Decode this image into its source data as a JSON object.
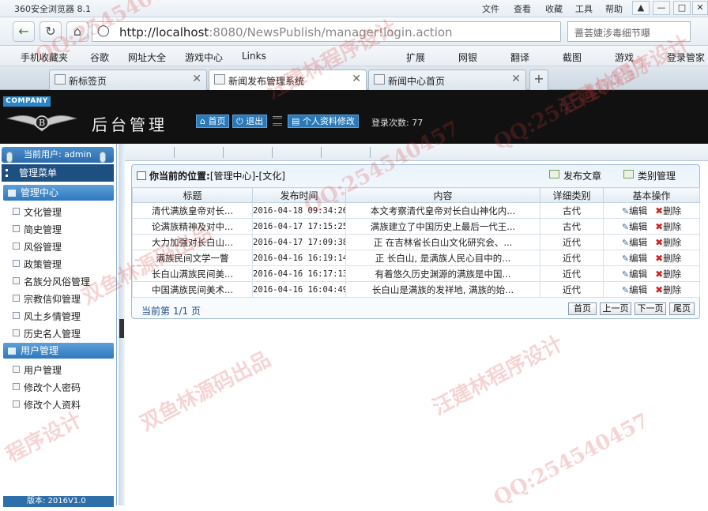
{
  "browser": {
    "title": "360安全浏览器 8.1",
    "menu": [
      "文件",
      "查看",
      "收藏",
      "工具",
      "帮助"
    ],
    "url_host": "http://localhost",
    "url_rest": ":8080/NewsPublish/manager!login.action",
    "search_text": "蔷荟婕涉毒细节曝",
    "favorites": [
      "手机收藏夹",
      "谷歌",
      "网址大全",
      "游戏中心",
      "Links"
    ],
    "tools": [
      "扩展",
      "网银",
      "翻译",
      "截图",
      "游戏",
      "登录管家"
    ],
    "tabs": [
      {
        "label": "新标签页",
        "active": false
      },
      {
        "label": "新闻发布管理系统",
        "active": true
      },
      {
        "label": "新闻中心首页",
        "active": false
      }
    ]
  },
  "header": {
    "company": "COMPANY",
    "title": "后台管理",
    "home_label": "首页",
    "logout_label": "退出",
    "profile_label": "个人资料修改",
    "login_count": "登录次数: 77"
  },
  "sidebar": {
    "current_user": "当前用户: admin",
    "menu_title": "管理菜单",
    "sections": [
      {
        "title": "管理中心",
        "items": [
          "文化管理",
          "简史管理",
          "风俗管理",
          "政策管理",
          "名族分风俗管理",
          "宗教信仰管理",
          "风土乡情管理",
          "历史名人管理"
        ]
      },
      {
        "title": "用户管理",
        "items": [
          "用户管理",
          "修改个人密码",
          "修改个人资料"
        ]
      }
    ],
    "version": "版本: 2016V1.0"
  },
  "content": {
    "location_label": "你当前的位置:",
    "location_value": "[管理中心]-[文化]",
    "publish_label": "发布文章",
    "category_label": "类别管理",
    "columns": [
      "标题",
      "发布时间",
      "内容",
      "详细类别",
      "基本操作"
    ],
    "rows": [
      {
        "title": "清代满族皇帝对长...",
        "time": "2016-04-18 09:34:26",
        "content": "本文考察清代皇帝对长白山神化内...",
        "category": "古代"
      },
      {
        "title": "论满族精神及对中...",
        "time": "2016-04-17 17:15:25",
        "content": "满族建立了中国历史上最后一代王...",
        "category": "古代"
      },
      {
        "title": "大力加强对长白山...",
        "time": "2016-04-17 17:09:38",
        "content": "正 在吉林省长白山文化研究会、...",
        "category": "近代"
      },
      {
        "title": "满族民间文学一瞥",
        "time": "2016-04-16 16:19:14",
        "content": "正 长白山, 是满族人民心目中的...",
        "category": "近代"
      },
      {
        "title": "长白山满族民间美...",
        "time": "2016-04-16 16:17:13",
        "content": "有着悠久历史渊源的满族是中国...",
        "category": "近代"
      },
      {
        "title": "中国满族民间美术...",
        "time": "2016-04-16 16:04:49",
        "content": "长白山是满族的发祥地, 满族的始...",
        "category": "近代"
      }
    ],
    "edit_label": "编辑",
    "delete_label": "删除",
    "page_info": "当前第 1/1 页",
    "pager": [
      "首页",
      "上一页",
      "下一页",
      "尾页"
    ]
  },
  "watermarks": [
    "QQ:254540457",
    "汪建林程序设计",
    "双鱼林源码出品",
    "QQ:254540457",
    "汪建林程序设计",
    "双鱼林源码出品",
    "QQ:254540457",
    "程序设计",
    "QQ:254540457",
    "汪建林程序设计"
  ]
}
